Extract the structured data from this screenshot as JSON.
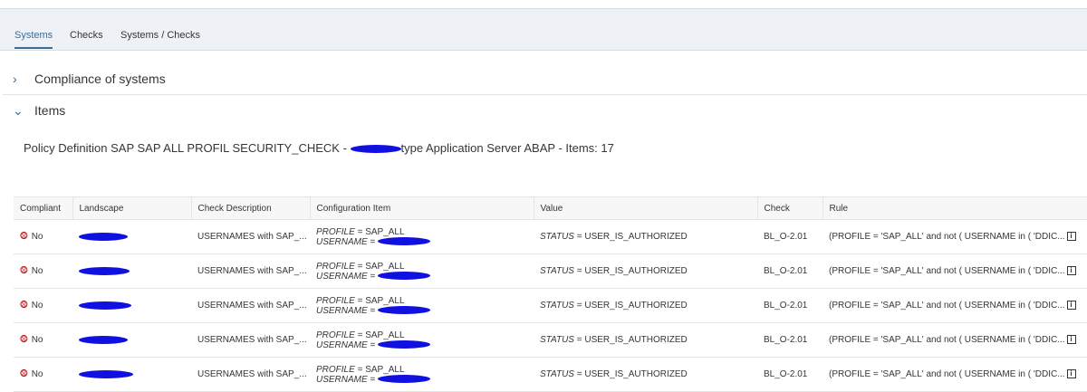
{
  "tabs": [
    {
      "label": "Systems",
      "active": true
    },
    {
      "label": "Checks"
    },
    {
      "label": "Systems / Checks"
    }
  ],
  "panels": {
    "compliance": "Compliance of systems",
    "items": "Items"
  },
  "title": {
    "prefix": "Policy Definition SAP SAP ALL PROFIL SECURITY_CHECK - ",
    "suffix": "type Application Server ABAP - Items: 17"
  },
  "table": {
    "headers": [
      "Compliant",
      "Landscape",
      "Check Description",
      "Configuration Item",
      "Value",
      "Check",
      "Rule"
    ],
    "rows": [
      {
        "compliant": "No",
        "description": "USERNAMES with SAP_...",
        "config_profile_key": "PROFILE",
        "config_profile_val": " = SAP_ALL",
        "config_user_key": "USERNAME",
        "config_user_val": " = ",
        "value_key": "STATUS",
        "value_val": " = USER_IS_AUTHORIZED",
        "check": "BL_O-2.01",
        "rule": "(PROFILE = 'SAP_ALL' and not ( USERNAME in ( 'DDIC..."
      },
      {
        "compliant": "No",
        "description": "USERNAMES with SAP_...",
        "config_profile_key": "PROFILE",
        "config_profile_val": " = SAP_ALL",
        "config_user_key": "USERNAME",
        "config_user_val": " = ",
        "value_key": "STATUS",
        "value_val": " = USER_IS_AUTHORIZED",
        "check": "BL_O-2.01",
        "rule": "(PROFILE = 'SAP_ALL' and not ( USERNAME in ( 'DDIC..."
      },
      {
        "compliant": "No",
        "description": "USERNAMES with SAP_...",
        "config_profile_key": "PROFILE",
        "config_profile_val": " = SAP_ALL",
        "config_user_key": "USERNAME",
        "config_user_val": " = ",
        "value_key": "STATUS",
        "value_val": " = USER_IS_AUTHORIZED",
        "check": "BL_O-2.01",
        "rule": "(PROFILE = 'SAP_ALL' and not ( USERNAME in ( 'DDIC..."
      },
      {
        "compliant": "No",
        "description": "USERNAMES with SAP_...",
        "config_profile_key": "PROFILE",
        "config_profile_val": " = SAP_ALL",
        "config_user_key": "USERNAME",
        "config_user_val": " = ",
        "value_key": "STATUS",
        "value_val": " = USER_IS_AUTHORIZED",
        "check": "BL_O-2.01",
        "rule": "(PROFILE = 'SAP_ALL' and not ( USERNAME in ( 'DDIC..."
      },
      {
        "compliant": "No",
        "description": "USERNAMES with SAP_...",
        "config_profile_key": "PROFILE",
        "config_profile_val": " = SAP_ALL",
        "config_user_key": "USERNAME",
        "config_user_val": " = ",
        "value_key": "STATUS",
        "value_val": " = USER_IS_AUTHORIZED",
        "check": "BL_O-2.01",
        "rule": "(PROFILE = 'SAP_ALL' and not ( USERNAME in ( 'DDIC..."
      }
    ]
  },
  "colors": {
    "accent": "#3a6d9a",
    "negative": "#bb0000",
    "redaction": "#1010e0"
  },
  "icons": {
    "expand": "chevron-right-icon",
    "collapse": "chevron-down-icon",
    "status": "status-negative-icon",
    "info": "info-icon"
  }
}
